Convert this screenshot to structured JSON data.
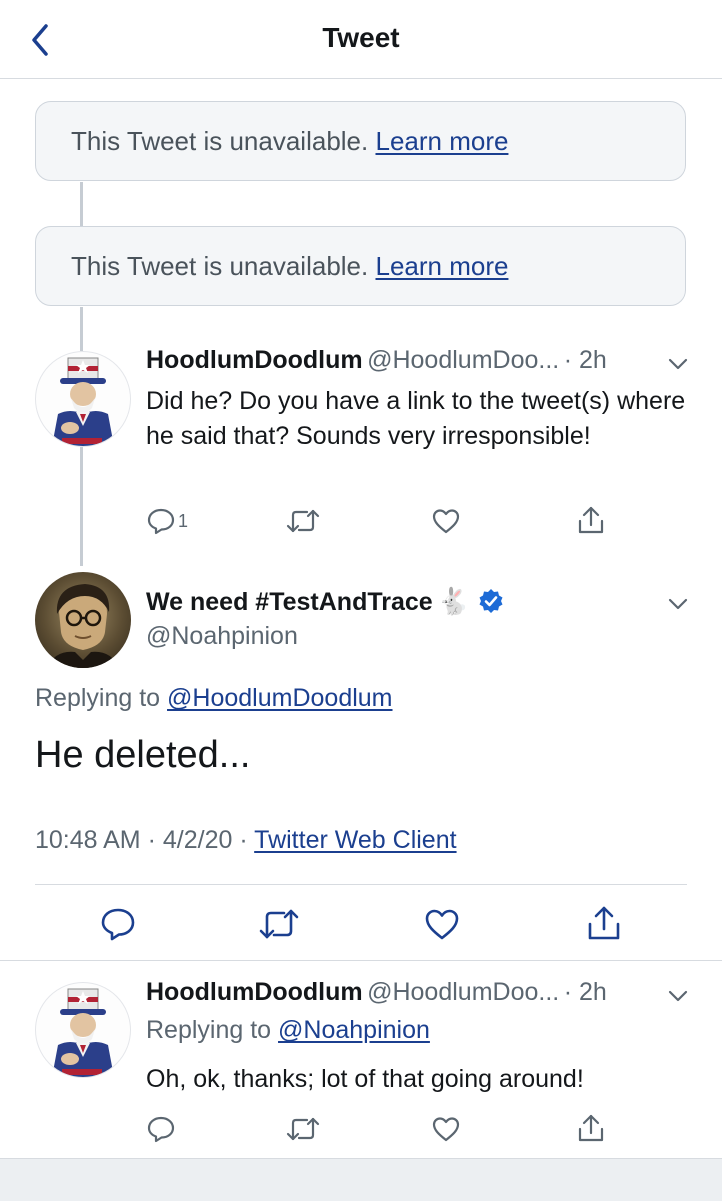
{
  "header": {
    "title": "Tweet"
  },
  "unavailable": [
    {
      "text": "This Tweet is unavailable.",
      "link": "Learn more"
    },
    {
      "text": "This Tweet is unavailable.",
      "link": "Learn more"
    }
  ],
  "reply1": {
    "name": "HoodlumDoodlum",
    "handle": "@HoodlumDoo...",
    "time": "· 2h",
    "text": "Did he? Do you have a link to the tweet(s) where he said that? Sounds very irresponsible!",
    "reply_count": "1"
  },
  "main": {
    "name": "We need #TestAndTrace",
    "emoji": "🐇",
    "handle": "@Noahpinion",
    "replying_prefix": "Replying to",
    "replying_to": "@HoodlumDoodlum",
    "text": "He deleted...",
    "time": "10:48 AM",
    "date": "4/2/20",
    "client": "Twitter Web Client",
    "sep": "·"
  },
  "reply2": {
    "name": "HoodlumDoodlum",
    "handle": "@HoodlumDoo...",
    "time": "· 2h",
    "replying_prefix": "Replying to",
    "replying_to": "@Noahpinion",
    "text": "Oh, ok, thanks; lot of that going around!"
  },
  "icons": {
    "back": "chevron-left-icon",
    "reply": "reply-icon",
    "retweet": "retweet-icon",
    "like": "heart-icon",
    "share": "share-icon",
    "caret": "chevron-down-icon",
    "verified": "verified-badge-icon"
  },
  "colors": {
    "accent": "#1b3f8f",
    "verified": "#1d6bd6",
    "muted": "#5b6670",
    "divider": "#d7dbe0"
  }
}
